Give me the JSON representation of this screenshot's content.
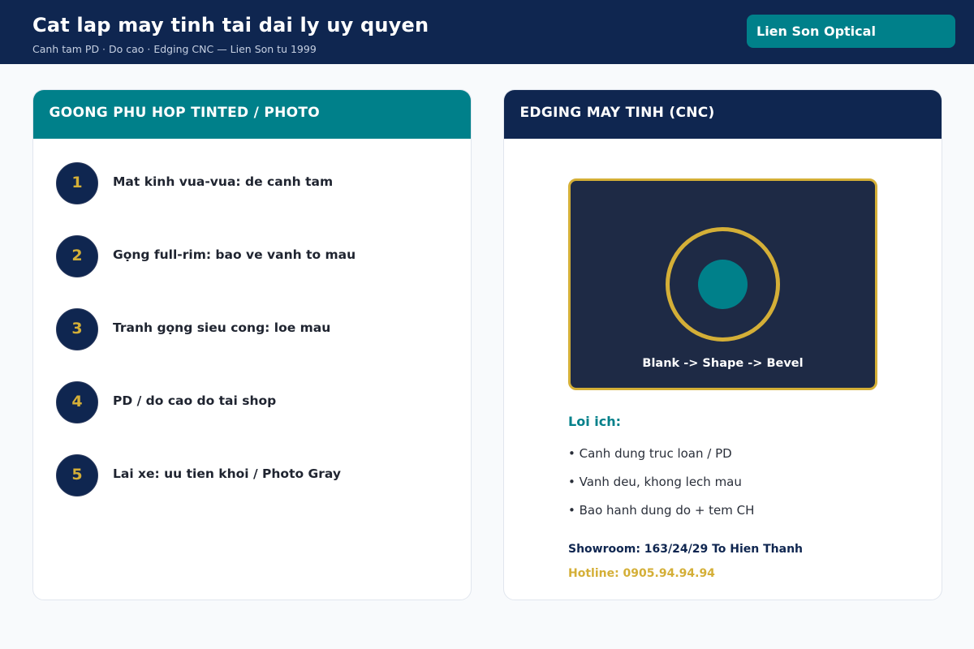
{
  "header": {
    "title": "Cat lap may tinh tai dai ly uy quyen",
    "subtitle": "Canh tam PD · Do cao · Edging CNC — Lien Son tu 1999",
    "brand": "Lien Son Optical"
  },
  "left_panel": {
    "title": "GOONG PHU HOP TINTED / PHOTO",
    "steps": [
      {
        "number": "1",
        "text": "Mat kinh vua-vua: de canh tam"
      },
      {
        "number": "2",
        "text": "Gọng full-rim: bao ve vanh to mau"
      },
      {
        "number": "3",
        "text": "Tranh gọng sieu cong: loe mau"
      },
      {
        "number": "4",
        "text": "PD / do cao do tai shop"
      },
      {
        "number": "5",
        "text": "Lai xe: uu tien khoi / Photo Gray"
      }
    ]
  },
  "right_panel": {
    "title": "EDGING MAY TINH (CNC)",
    "diagram_caption": "Blank -> Shape -> Bevel",
    "benefits_title": "Loi ich:",
    "benefits": [
      "• Canh dung truc loan / PD",
      "• Vanh deu, khong lech mau",
      "• Bao hanh dung do + tem CH"
    ],
    "showroom": "Showroom: 163/24/29 To Hien Thanh",
    "hotline": "Hotline: 0905.94.94.94"
  },
  "colors": {
    "navy": "#0f2650",
    "teal": "#00808a",
    "gold": "#d4af37",
    "diagram_bg": "#1e2a45",
    "page_bg": "#f8fafc"
  }
}
